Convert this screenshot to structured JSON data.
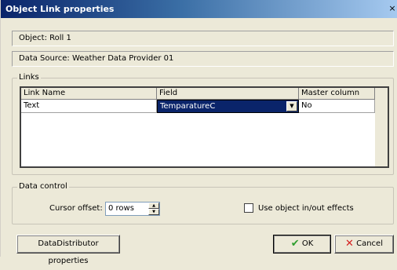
{
  "window": {
    "title": "Object Link properties"
  },
  "info": {
    "object": "Object: Roll 1",
    "data_source": "Data Source: Weather Data Provider 01"
  },
  "links": {
    "legend": "Links",
    "columns": [
      "Link Name",
      "Field",
      "Master column"
    ],
    "rows": [
      {
        "link_name": "Text",
        "field": "TemparatureC",
        "master_column": "No"
      }
    ]
  },
  "data_control": {
    "legend": "Data control",
    "cursor_offset_label": "Cursor offset:",
    "cursor_offset_value": "0 rows",
    "use_effects_label": "Use object in/out effects",
    "use_effects_checked": false
  },
  "buttons": {
    "data_distributor": "DataDistributor properties",
    "ok": "OK",
    "cancel": "Cancel"
  },
  "colors": {
    "titlebar_start": "#0a246a",
    "titlebar_end": "#a6caf0",
    "ok_check": "#2e9e2e",
    "cancel_x": "#d42020",
    "selection": "#0a246a"
  }
}
